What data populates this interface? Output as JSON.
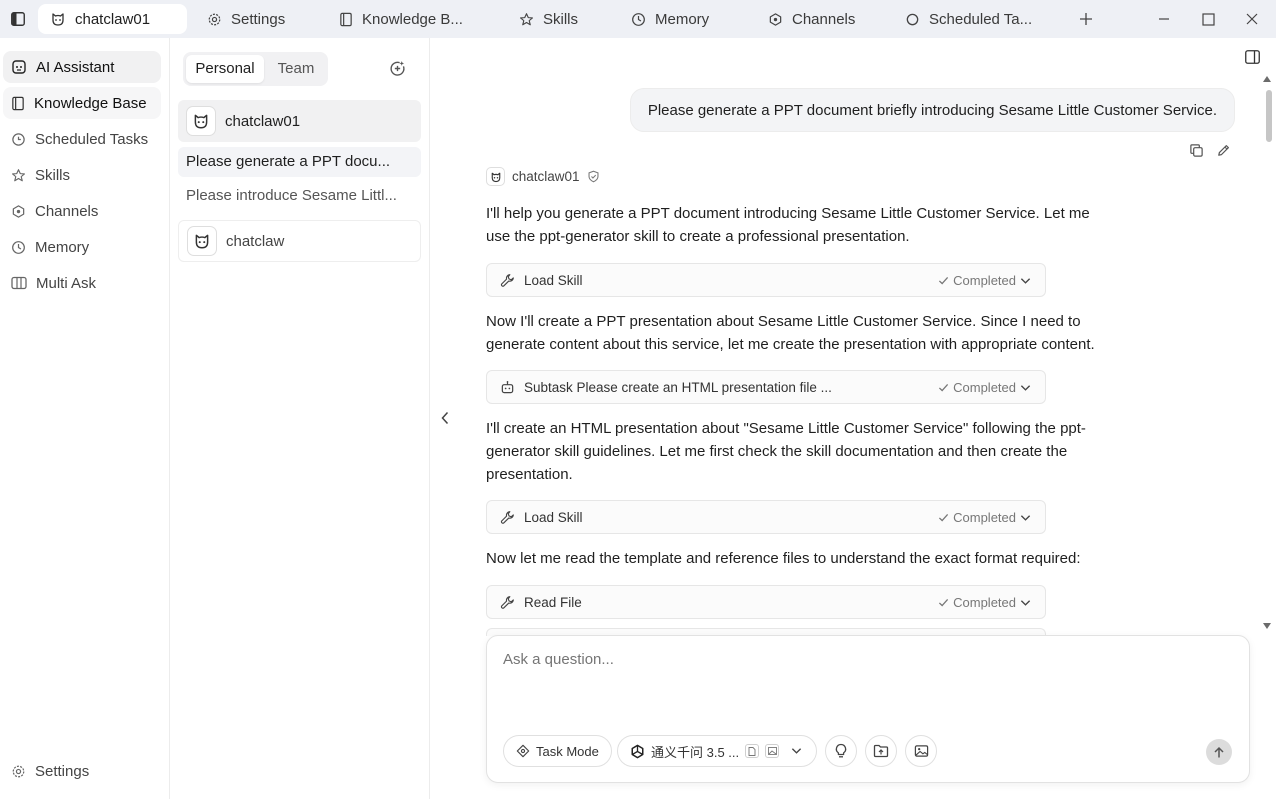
{
  "tabs": [
    {
      "label": "chatclaw01",
      "icon": "bot-face-icon",
      "active": true
    },
    {
      "label": "Settings",
      "icon": "gear-icon"
    },
    {
      "label": "Knowledge B...",
      "icon": "book-icon"
    },
    {
      "label": "Skills",
      "icon": "star-icon"
    },
    {
      "label": "Memory",
      "icon": "clock-icon"
    },
    {
      "label": "Channels",
      "icon": "hub-icon"
    },
    {
      "label": "Scheduled Ta...",
      "icon": "radio-circle-icon"
    }
  ],
  "nav": {
    "items": [
      {
        "label": "AI Assistant",
        "icon": "bot-face-icon"
      },
      {
        "label": "Knowledge Base",
        "icon": "book-icon"
      },
      {
        "label": "Scheduled Tasks",
        "icon": "timer-icon"
      },
      {
        "label": "Skills",
        "icon": "star-icon"
      },
      {
        "label": "Channels",
        "icon": "hub-icon"
      },
      {
        "label": "Memory",
        "icon": "clock-icon"
      },
      {
        "label": "Multi Ask",
        "icon": "columns-icon"
      }
    ],
    "settings_label": "Settings"
  },
  "conversations": {
    "segments": [
      "Personal",
      "Team"
    ],
    "agents": [
      {
        "name": "chatclaw01"
      },
      {
        "name": "chatclaw"
      }
    ],
    "threads": [
      "Please generate a PPT docu...",
      "Please introduce Sesame Littl..."
    ]
  },
  "chat": {
    "user_message": "Please generate a PPT document briefly introducing Sesame Little Customer Service.",
    "assistant_name": "chatclaw01",
    "paragraphs": [
      "I'll help you generate a PPT document introducing Sesame Little Customer Service. Let me use the ppt-generator skill to create a professional presentation.",
      "Now I'll create a PPT presentation about Sesame Little Customer Service. Since I need to generate content about this service, let me create the presentation with appropriate content.",
      "I'll create an HTML presentation about \"Sesame Little Customer Service\" following the ppt-generator skill guidelines. Let me first check the skill documentation and then create the presentation.",
      "Now let me read the template and reference files to understand the exact format required:"
    ],
    "tools": [
      {
        "label": "Load Skill",
        "status": "Completed",
        "icon": "wrench-icon"
      },
      {
        "label": "Subtask Please create an HTML presentation file ...",
        "status": "Completed",
        "icon": "robot-icon"
      },
      {
        "label": "Load Skill",
        "status": "Completed",
        "icon": "wrench-icon"
      },
      {
        "label": "Read File",
        "status": "Completed",
        "icon": "wrench-icon"
      }
    ]
  },
  "composer": {
    "placeholder": "Ask a question...",
    "task_mode_label": "Task Mode",
    "model_label": "通义千问 3.5 ..."
  }
}
